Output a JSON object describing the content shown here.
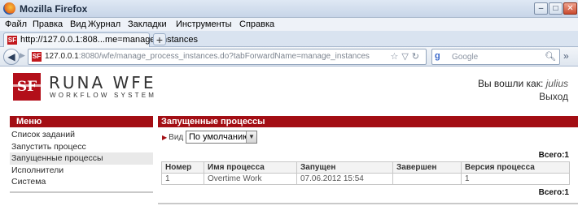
{
  "window": {
    "title": "Mozilla Firefox",
    "minimize": "–",
    "maximize": "□",
    "close": "✕"
  },
  "menubar": [
    "Файл",
    "Правка",
    "Вид",
    "Журнал",
    "Закладки",
    "Инструменты",
    "Справка"
  ],
  "tab": {
    "label": "http://127.0.0.1:808...me=manage_instances",
    "new_tab": "+"
  },
  "nav": {
    "url_host": "127.0.0.1",
    "url_rest": ":8080/wfe/manage_process_instances.do?tabForwardName=manage_instances",
    "search_placeholder": "Google",
    "search_engine_glyph": "g"
  },
  "header": {
    "logo_badge": "SF",
    "logo_name": "RUNA WFE",
    "logo_sub": "WORKFLOW SYSTEM",
    "logged_in_prefix": "Вы вошли как:",
    "username": "julius",
    "logout": "Выход"
  },
  "sidebar": {
    "title": "Меню",
    "items": [
      {
        "label": "Список заданий"
      },
      {
        "label": "Запустить процесс"
      },
      {
        "label": "Запущенные процессы",
        "active": true
      },
      {
        "label": "Исполнители"
      },
      {
        "label": "Система"
      }
    ]
  },
  "main": {
    "title": "Запущенные процессы",
    "view_label": "Вид",
    "view_selected": "По умолчанию",
    "total_top": "Всего:1",
    "total_bottom": "Всего:1",
    "table": {
      "columns": [
        "Номер",
        "Имя процесса",
        "Запущен",
        "Завершен",
        "Версия процесса"
      ],
      "rows": [
        [
          "1",
          "Overtime Work",
          "07.06.2012 15:54",
          "",
          "1"
        ]
      ]
    }
  },
  "colors": {
    "accent": "#a30e14"
  }
}
